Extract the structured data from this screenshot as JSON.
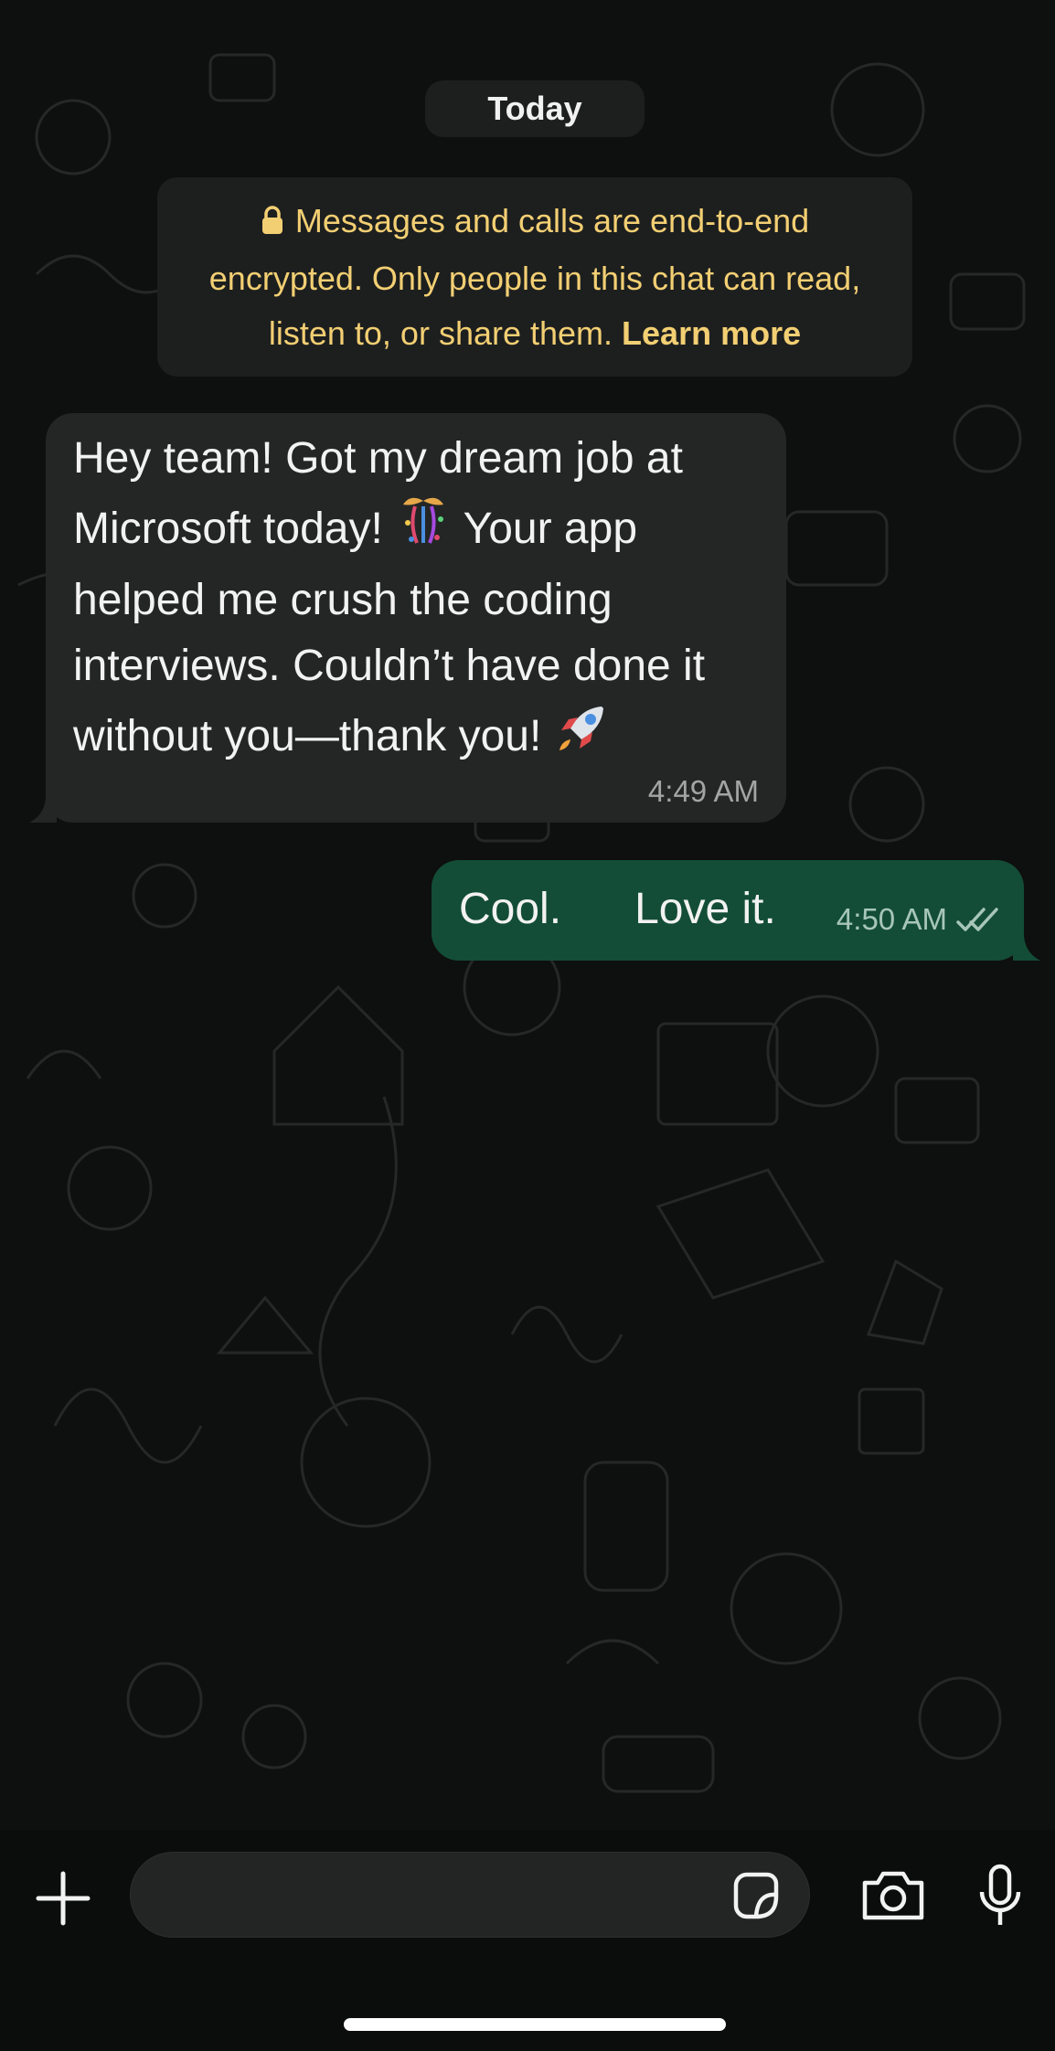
{
  "date_divider": "Today",
  "encryption_notice": {
    "text": "Messages and calls are end-to-end encrypted. Only people in this chat can read, listen to, or share them.",
    "link": "Learn more",
    "color": "#f3cf73"
  },
  "messages": [
    {
      "direction": "incoming",
      "lines": [
        "Hey team! Got my dream job at",
        "Microsoft today!",
        "Your app",
        "helped me crush the coding",
        "interviews. Couldn’t have done it",
        "without you—thank you!"
      ],
      "emojis": [
        "confetti",
        "rocket"
      ],
      "time": "4:49 AM"
    },
    {
      "direction": "outgoing",
      "text": "Cool.      Love it.",
      "time": "4:50 AM",
      "status": "delivered-double-check"
    }
  ],
  "composer": {
    "placeholder": "",
    "icons": [
      "plus-icon",
      "sticker-icon",
      "camera-icon",
      "microphone-icon"
    ]
  },
  "colors": {
    "incoming_bubble": "#242626",
    "outgoing_bubble": "#134d37",
    "background": "#0e0f0f"
  }
}
